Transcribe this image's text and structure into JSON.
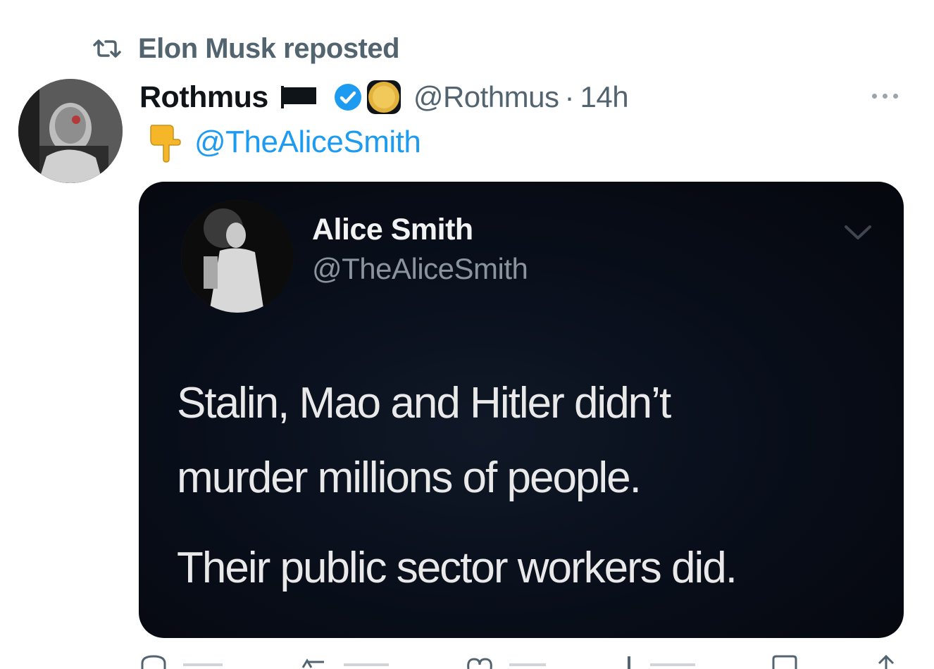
{
  "repost_banner": {
    "text": "Elon Musk reposted",
    "icon": "repost-icon"
  },
  "author": {
    "display_name": "Rothmus",
    "handle": "@Rothmus",
    "separator": "·",
    "time": "14h",
    "icons": [
      "black-flag-icon",
      "verified-badge-icon",
      "gold-coin-icon"
    ]
  },
  "reply_line": {
    "icon": "pointing-down-hand-icon",
    "mention": "@TheAliceSmith"
  },
  "embedded_image": {
    "name": "Alice Smith",
    "handle": "@TheAliceSmith",
    "lines": [
      "Stalin, Mao and Hitler didn’t",
      "murder millions of people.",
      "Their public sector workers did."
    ]
  },
  "actions": [
    "reply-icon",
    "repost-icon",
    "like-icon",
    "views-icon",
    "bookmark-icon",
    "share-icon"
  ],
  "colors": {
    "link_blue": "#1d9bf0",
    "secondary_text": "#536471",
    "card_bg": "#070b14"
  }
}
